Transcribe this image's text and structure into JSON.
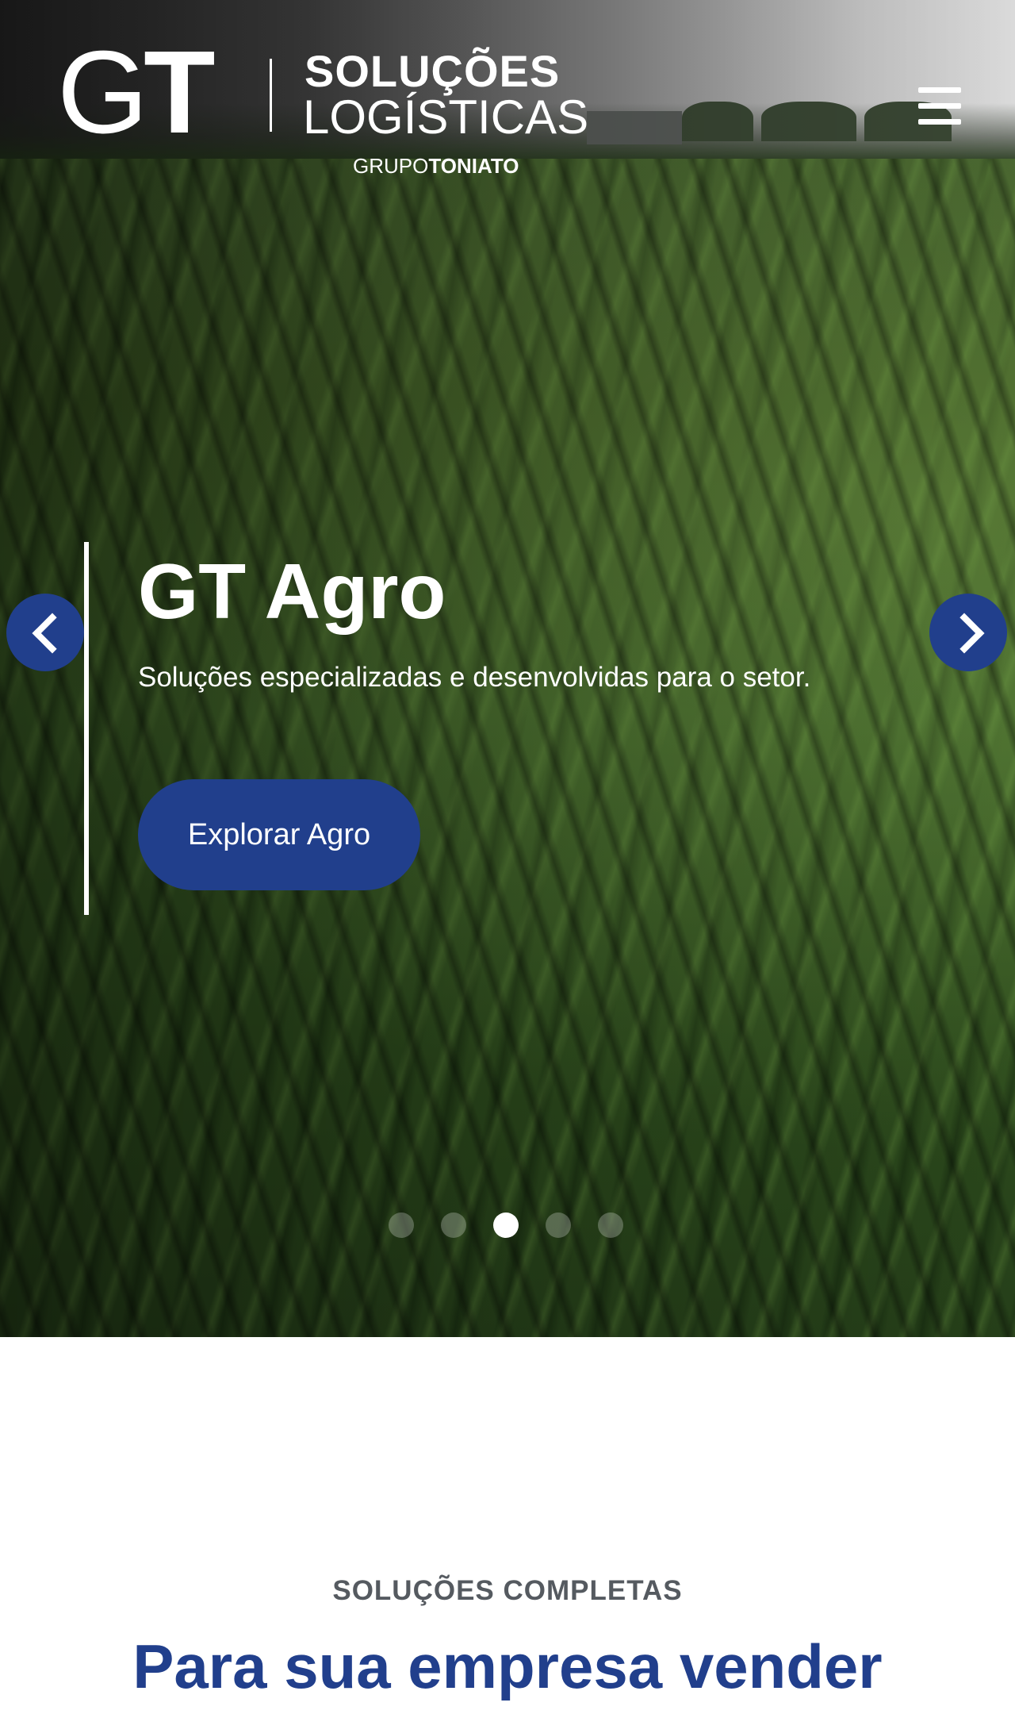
{
  "brand": {
    "mark_light": "G",
    "mark_bold": "T",
    "line1": "SOLUÇÕES",
    "line2": "LOGÍSTICAS",
    "group_light": "GRUPO",
    "group_bold": "TONIATO"
  },
  "header": {
    "menu_icon": "hamburger-menu-icon"
  },
  "hero": {
    "slide": {
      "title": "GT Agro",
      "subtitle": "Soluções especializadas e desenvolvidas para o setor.",
      "cta_label": "Explorar Agro"
    },
    "prev_icon": "chevron-left-icon",
    "next_icon": "chevron-right-icon",
    "slides_total": 5,
    "active_slide": 3
  },
  "section": {
    "kicker": "SOLUÇÕES COMPLETAS",
    "title": "Para sua empresa vender"
  },
  "colors": {
    "brand_blue": "#213f8c",
    "kicker_gray": "#555a60",
    "white": "#ffffff"
  }
}
